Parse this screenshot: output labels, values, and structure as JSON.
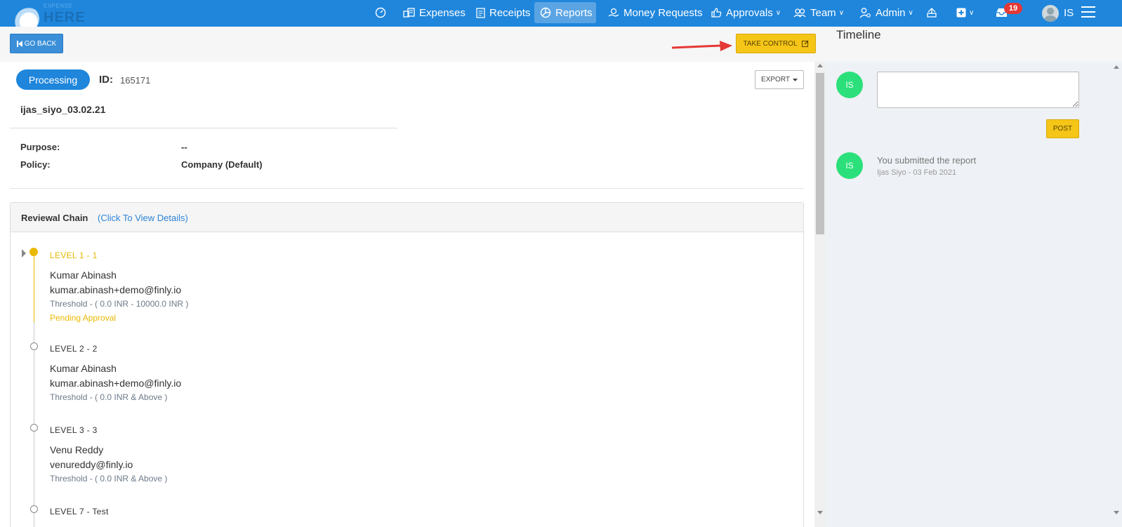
{
  "brand": {
    "small": "EXPENSE",
    "big": "HERE"
  },
  "nav": {
    "expenses": "Expenses",
    "receipts": "Receipts",
    "reports": "Reports",
    "money_requests": "Money Requests",
    "approvals": "Approvals",
    "team": "Team",
    "admin": "Admin",
    "notification_count": "19",
    "user_initials": "IS"
  },
  "toolbar": {
    "go_back": "GO BACK",
    "take_control": "TAKE CONTROL"
  },
  "report": {
    "status": "Processing",
    "id_label": "ID:",
    "id_value": "165171",
    "export_label": "EXPORT",
    "name": "ijas_siyo_03.02.21",
    "fields": [
      {
        "label": "Purpose:",
        "value": "--"
      },
      {
        "label": "Policy:",
        "value": "Company (Default)"
      }
    ]
  },
  "chain": {
    "title": "Reviewal Chain",
    "link": "(Click To View Details)",
    "levels": [
      {
        "title": "LEVEL 1  -   1",
        "name": "Kumar Abinash",
        "email": "kumar.abinash+demo@finly.io",
        "threshold": "Threshold -  ( 0.0 INR - 10000.0 INR )",
        "status": "Pending Approval"
      },
      {
        "title": "LEVEL 2  -   2",
        "name": "Kumar Abinash",
        "email": "kumar.abinash+demo@finly.io",
        "threshold": "Threshold -  ( 0.0 INR & Above )"
      },
      {
        "title": "LEVEL 3  -   3",
        "name": "Venu Reddy",
        "email": "venureddy@finly.io",
        "threshold": "Threshold -  ( 0.0 INR & Above )"
      },
      {
        "title": "LEVEL 7  -   Test"
      }
    ]
  },
  "timeline": {
    "title": "Timeline",
    "avatar_initials": "IS",
    "post_label": "POST",
    "comment_placeholder": "",
    "activity": {
      "text": "You submitted the report",
      "meta": "Ijas Siyo - 03 Feb 2021"
    }
  },
  "colors": {
    "primary": "#1f86dc",
    "warning": "#f5c518",
    "avatar": "#2be07a",
    "badge": "#e53935"
  }
}
